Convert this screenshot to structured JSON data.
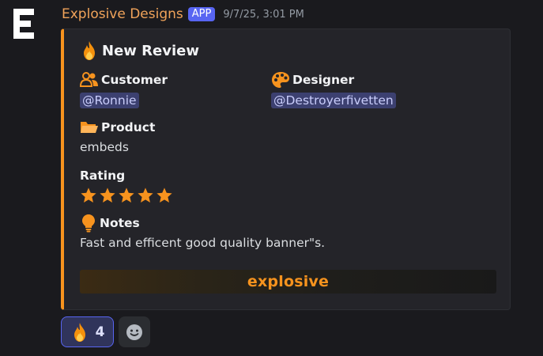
{
  "message": {
    "author": "Explosive Designs",
    "badge": "APP",
    "timestamp": "9/7/25, 3:01 PM",
    "avatar_letter": "E"
  },
  "embed": {
    "accent_color": "#f7931e",
    "title": "New Review",
    "title_icon": "fire-icon",
    "fields": {
      "customer": {
        "name": "Customer",
        "icon": "user-icon",
        "value": "@Ronnie"
      },
      "designer": {
        "name": "Designer",
        "icon": "palette-icon",
        "value": "@Destroyerfivetten"
      },
      "product": {
        "name": "Product",
        "icon": "folder-icon",
        "value": "embeds"
      },
      "rating": {
        "name": "Rating",
        "stars": 5,
        "max": 5
      },
      "notes": {
        "name": "Notes",
        "icon": "lightbulb-icon",
        "value": "Fast and efficent good quality banner\"s."
      }
    },
    "banner": {
      "text": "explosive"
    }
  },
  "reactions": [
    {
      "emoji": "fire-icon",
      "count": "4",
      "active": true
    },
    {
      "emoji": "add-reaction-icon"
    }
  ],
  "colors": {
    "background": "#1a1a1e",
    "embed_bg": "#242429",
    "accent": "#f7931e",
    "author": "#f0a35a",
    "mention_bg": "#3c4070",
    "badge": "#5865f2"
  }
}
